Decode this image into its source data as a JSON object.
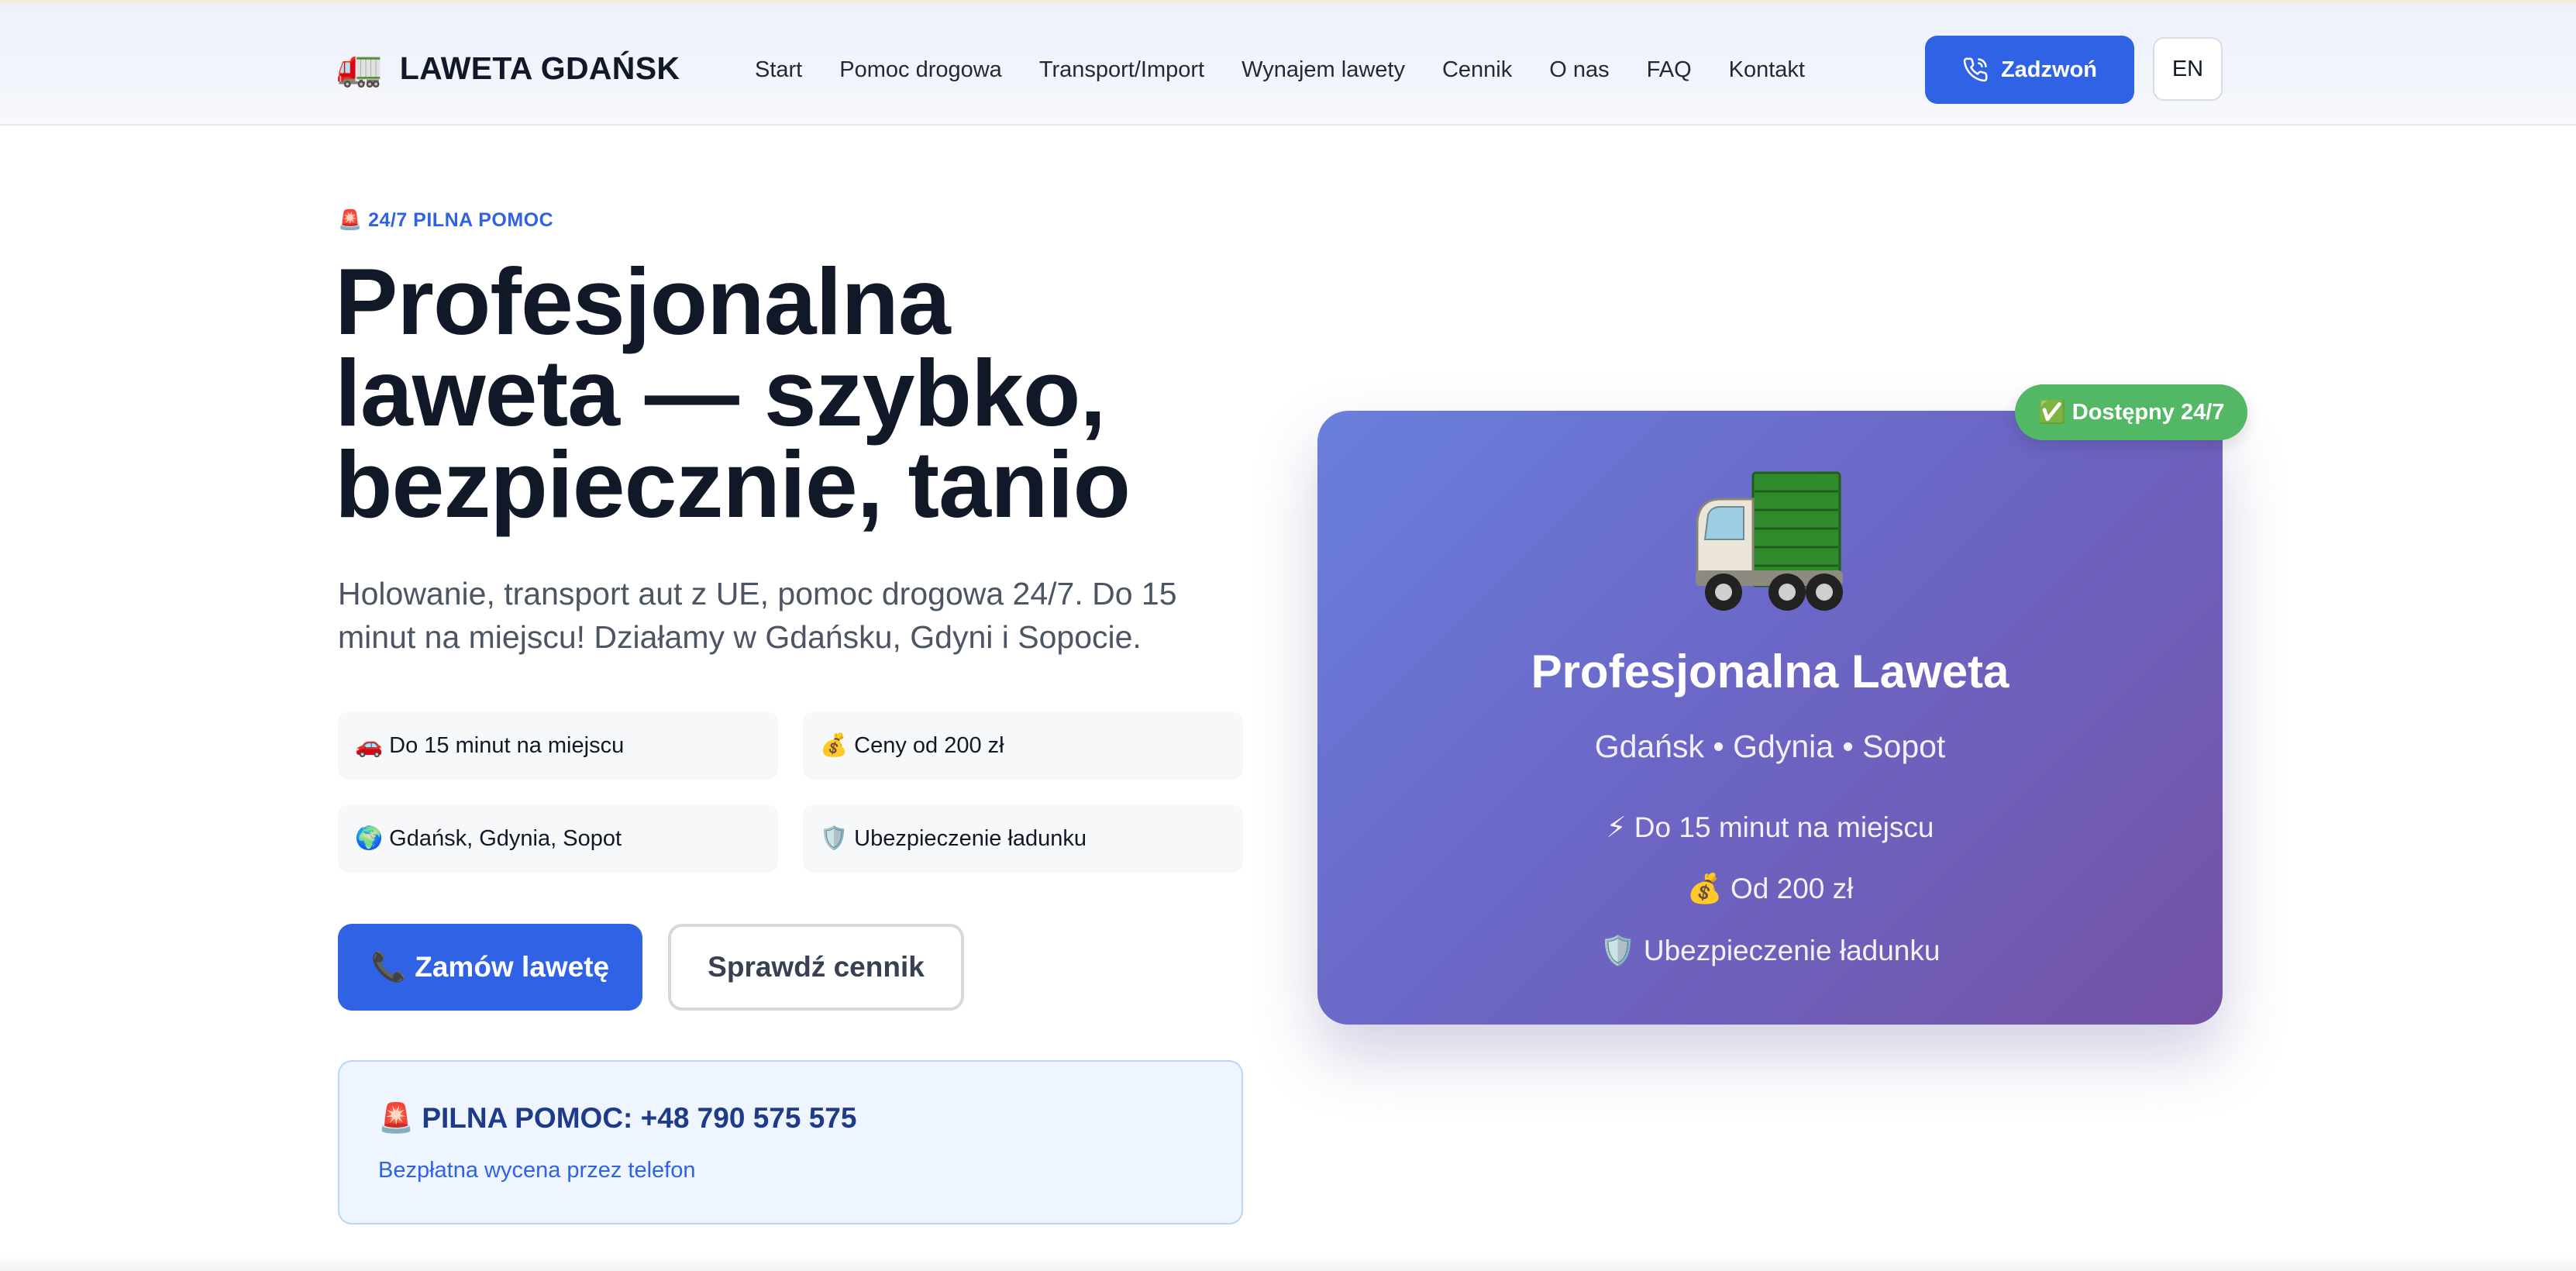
{
  "header": {
    "brand_icon": "🚛",
    "brand_name": "LAWETA GDAŃSK",
    "nav": [
      "Start",
      "Pomoc drogowa",
      "Transport/Import",
      "Wynajem lawety",
      "Cennik",
      "O nas",
      "FAQ",
      "Kontakt"
    ],
    "call_label": "Zadzwoń",
    "call_icon": "phone-icon",
    "lang_label": "EN"
  },
  "hero": {
    "badge": "🚨 24/7 PILNA POMOC",
    "title_lines": [
      "Profesjonalna",
      "laweta — szybko,",
      "bezpiecznie, tanio"
    ],
    "subtitle": "Holowanie, transport aut z UE, pomoc drogowa 24/7. Do 15 minut na miejscu! Działamy w Gdańsku, Gdyni i Sopocie.",
    "features": [
      "🚗 Do 15 minut na miejscu",
      "💰 Ceny od 200 zł",
      "🌍 Gdańsk, Gdynia, Sopot",
      "🛡️ Ubezpieczenie ładunku"
    ],
    "primary_cta": "📞 Zamów lawetę",
    "secondary_cta": "Sprawdź cennik",
    "emergency_title": "🚨 PILNA POMOC: +48 790 575 575",
    "emergency_note": "Bezpłatna wycena przez telefon"
  },
  "card": {
    "badge": "✅ Dostępny 24/7",
    "truck_icon": "truck-icon",
    "title": "Profesjonalna Laweta",
    "cities": "Gdańsk • Gdynia • Sopot",
    "lines": [
      "⚡  Do 15 minut na miejscu",
      "💰  Od 200 zł",
      "🛡️  Ubezpieczenie ładunku"
    ]
  },
  "colors": {
    "primary": "#2f62e4",
    "card_gradient_start": "#6a7fdc",
    "card_gradient_end": "#7452a6",
    "available": "#53b866"
  }
}
